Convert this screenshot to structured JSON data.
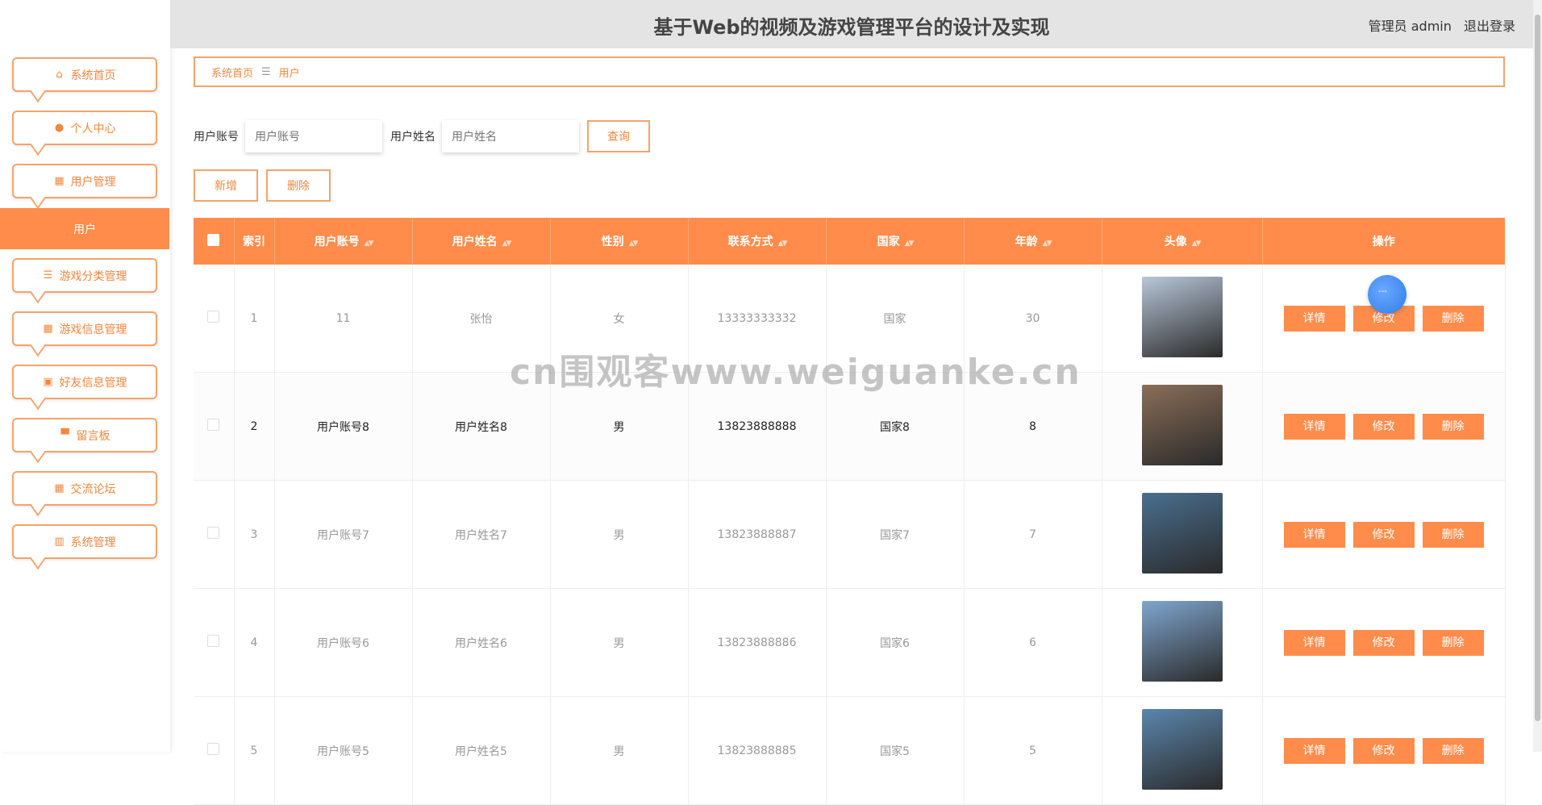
{
  "header": {
    "title": "基于Web的视频及游戏管理平台的设计及实现",
    "role": "管理员 admin",
    "logout": "退出登录"
  },
  "sidebar": {
    "items": [
      {
        "label": "系统首页",
        "icon": "home-icon",
        "glyph": "⌂"
      },
      {
        "label": "个人中心",
        "icon": "person-icon",
        "glyph": "●"
      },
      {
        "label": "用户管理",
        "icon": "grid-icon",
        "glyph": "▦"
      },
      {
        "label": "游戏分类管理",
        "icon": "sliders-icon",
        "glyph": "☰"
      },
      {
        "label": "游戏信息管理",
        "icon": "grid-icon",
        "glyph": "▦"
      },
      {
        "label": "好友信息管理",
        "icon": "briefcase-icon",
        "glyph": "▣"
      },
      {
        "label": "留言板",
        "icon": "board-icon",
        "glyph": "▀"
      },
      {
        "label": "交流论坛",
        "icon": "grid-icon",
        "glyph": "▦"
      },
      {
        "label": "系统管理",
        "icon": "book-icon",
        "glyph": "▥"
      }
    ],
    "active_sub": "用户"
  },
  "breadcrumb": {
    "home": "系统首页",
    "sep": "☰",
    "current": "用户"
  },
  "search": {
    "account_label": "用户账号",
    "account_placeholder": "用户账号",
    "name_label": "用户姓名",
    "name_placeholder": "用户姓名",
    "query": "查询"
  },
  "actions": {
    "add": "新增",
    "delete": "删除"
  },
  "table": {
    "columns": [
      "索引",
      "用户账号",
      "用户姓名",
      "性别",
      "联系方式",
      "国家",
      "年龄",
      "头像",
      "操作"
    ],
    "ops": {
      "detail": "详情",
      "edit": "修改",
      "delete": "删除"
    },
    "rows": [
      {
        "index": "1",
        "account": "11",
        "name": "张怡",
        "gender": "女",
        "phone": "13333333332",
        "country": "国家",
        "age": "30",
        "avatar_color": "#b8c7d9"
      },
      {
        "index": "2",
        "account": "用户账号8",
        "name": "用户姓名8",
        "gender": "男",
        "phone": "13823888888",
        "country": "国家8",
        "age": "8",
        "avatar_color": "#8a6e58"
      },
      {
        "index": "3",
        "account": "用户账号7",
        "name": "用户姓名7",
        "gender": "男",
        "phone": "13823888887",
        "country": "国家7",
        "age": "7",
        "avatar_color": "#4a6f8f"
      },
      {
        "index": "4",
        "account": "用户账号6",
        "name": "用户姓名6",
        "gender": "男",
        "phone": "13823888886",
        "country": "国家6",
        "age": "6",
        "avatar_color": "#7fa6cf"
      },
      {
        "index": "5",
        "account": "用户账号5",
        "name": "用户姓名5",
        "gender": "男",
        "phone": "13823888885",
        "country": "国家5",
        "age": "5",
        "avatar_color": "#5b86ad"
      }
    ]
  },
  "watermark": "cn围观客www.weiguanke.cn",
  "colors": {
    "accent": "#ff8c4b",
    "accent_border": "#f3a36b",
    "accent_text": "#f0873e"
  }
}
